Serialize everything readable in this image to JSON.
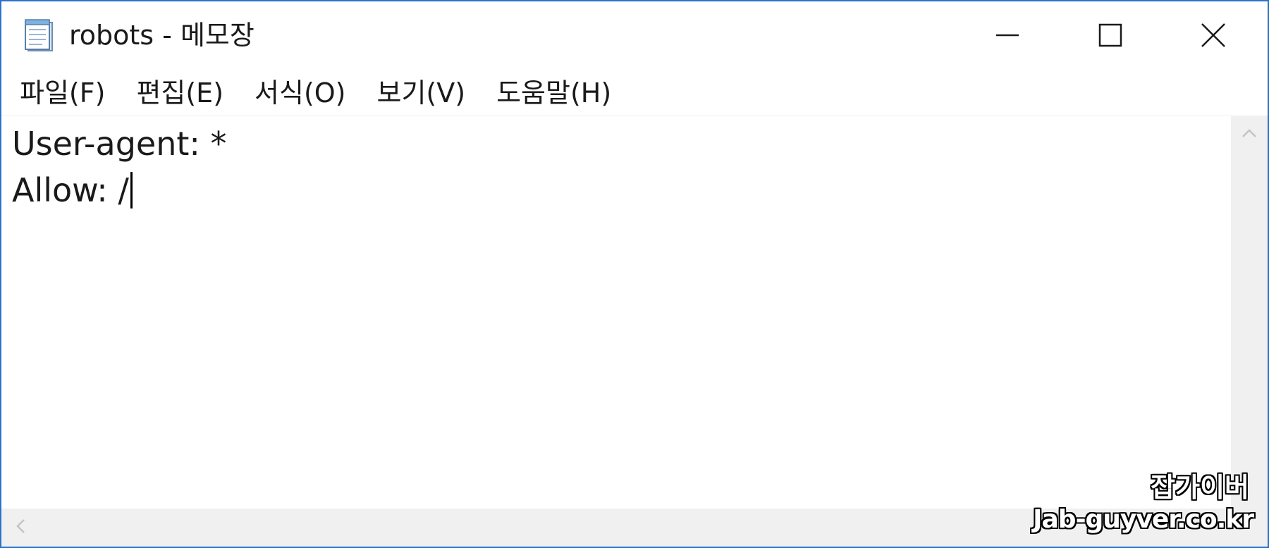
{
  "window": {
    "title": "robots - 메모장",
    "app_icon": "notepad-icon",
    "controls": {
      "minimize": "minimize-icon",
      "maximize": "maximize-icon",
      "close": "close-icon"
    }
  },
  "menu": {
    "items": [
      {
        "label": "파일(F)"
      },
      {
        "label": "편집(E)"
      },
      {
        "label": "서식(O)"
      },
      {
        "label": "보기(V)"
      },
      {
        "label": "도움말(H)"
      }
    ]
  },
  "editor": {
    "lines": [
      "User-agent: *",
      "Allow: /"
    ]
  },
  "watermark": {
    "name": "잡가이버",
    "url": "Jab-guyver.co.kr"
  },
  "colors": {
    "window_border": "#2a73c7",
    "scrollbar": "#f0f0f0",
    "text": "#1a1a1a"
  }
}
